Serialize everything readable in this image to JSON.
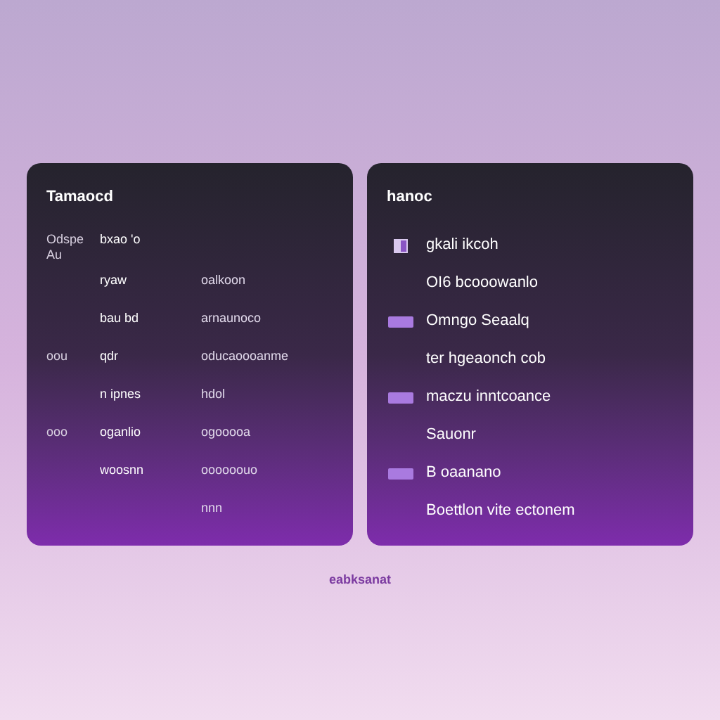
{
  "left_panel": {
    "title": "Tamaocd",
    "rows": [
      {
        "label": "Odspe Au",
        "column_1": "bxao 'o",
        "column_2": ""
      },
      {
        "label": "",
        "column_1": "ryaw",
        "column_2": "oalkoon"
      },
      {
        "label": "",
        "column_1": "bau bd",
        "column_2": "arnaunoco"
      },
      {
        "label": "oou",
        "column_1": "qdr",
        "column_2": "oducaoooanme"
      },
      {
        "label": "",
        "column_1": "n ipnes",
        "column_2": "hdol"
      },
      {
        "label": "ooo",
        "column_1": "oganlio",
        "column_2": "ogooooa"
      },
      {
        "label": "",
        "column_1": "woosnn",
        "column_2": "oooooouo"
      },
      {
        "label": "",
        "column_1": "",
        "column_2": "nnn"
      }
    ]
  },
  "right_panel": {
    "title": "hanoc",
    "items": [
      {
        "kind": "icon",
        "text": "gkali ikcoh"
      },
      {
        "kind": "plain",
        "text": "OI6 bcooowanlo"
      },
      {
        "kind": "swatch",
        "text": "Omngo Seaalq"
      },
      {
        "kind": "plain",
        "text": "ter hgeaonch cob"
      },
      {
        "kind": "swatch",
        "text": "maczu inntcoance"
      },
      {
        "kind": "plain",
        "text": "Sauonr"
      },
      {
        "kind": "swatch",
        "text": "B oaanano"
      },
      {
        "kind": "plain",
        "text": "Boettlon vite ectonem"
      }
    ]
  },
  "footer": "eabksanat"
}
